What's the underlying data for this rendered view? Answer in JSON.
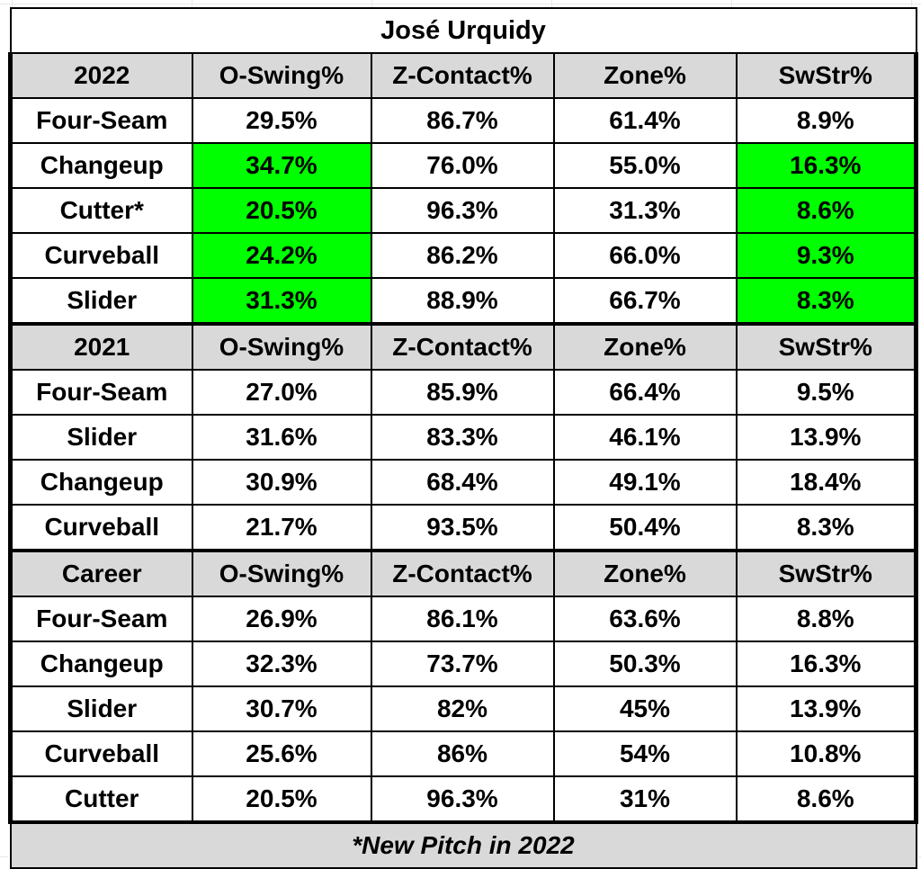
{
  "title": "José Urquidy",
  "footnote": "*New Pitch in 2022",
  "colors": {
    "highlight": "#00ff00",
    "header_gray": "#d9d9d9",
    "border": "#000000",
    "cell_bg": "#ffffff"
  },
  "sections": [
    {
      "id": "2022",
      "headers": [
        "2022",
        "O-Swing%",
        "Z-Contact%",
        "Zone%",
        "SwStr%"
      ],
      "rows": [
        {
          "pitch": "Four-Seam",
          "o_swing": "29.5%",
          "z_contact": "86.7%",
          "zone": "61.4%",
          "swstr": "8.9%",
          "hl_o_swing": false,
          "hl_swstr": false
        },
        {
          "pitch": "Changeup",
          "o_swing": "34.7%",
          "z_contact": "76.0%",
          "zone": "55.0%",
          "swstr": "16.3%",
          "hl_o_swing": true,
          "hl_swstr": true
        },
        {
          "pitch": "Cutter*",
          "o_swing": "20.5%",
          "z_contact": "96.3%",
          "zone": "31.3%",
          "swstr": "8.6%",
          "hl_o_swing": true,
          "hl_swstr": true
        },
        {
          "pitch": "Curveball",
          "o_swing": "24.2%",
          "z_contact": "86.2%",
          "zone": "66.0%",
          "swstr": "9.3%",
          "hl_o_swing": true,
          "hl_swstr": true
        },
        {
          "pitch": "Slider",
          "o_swing": "31.3%",
          "z_contact": "88.9%",
          "zone": "66.7%",
          "swstr": "8.3%",
          "hl_o_swing": true,
          "hl_swstr": true
        }
      ]
    },
    {
      "id": "2021",
      "headers": [
        "2021",
        "O-Swing%",
        "Z-Contact%",
        "Zone%",
        "SwStr%"
      ],
      "rows": [
        {
          "pitch": "Four-Seam",
          "o_swing": "27.0%",
          "z_contact": "85.9%",
          "zone": "66.4%",
          "swstr": "9.5%",
          "hl_o_swing": false,
          "hl_swstr": false
        },
        {
          "pitch": "Slider",
          "o_swing": "31.6%",
          "z_contact": "83.3%",
          "zone": "46.1%",
          "swstr": "13.9%",
          "hl_o_swing": false,
          "hl_swstr": false
        },
        {
          "pitch": "Changeup",
          "o_swing": "30.9%",
          "z_contact": "68.4%",
          "zone": "49.1%",
          "swstr": "18.4%",
          "hl_o_swing": false,
          "hl_swstr": false
        },
        {
          "pitch": "Curveball",
          "o_swing": "21.7%",
          "z_contact": "93.5%",
          "zone": "50.4%",
          "swstr": "8.3%",
          "hl_o_swing": false,
          "hl_swstr": false
        }
      ]
    },
    {
      "id": "Career",
      "headers": [
        "Career",
        "O-Swing%",
        "Z-Contact%",
        "Zone%",
        "SwStr%"
      ],
      "rows": [
        {
          "pitch": "Four-Seam",
          "o_swing": "26.9%",
          "z_contact": "86.1%",
          "zone": "63.6%",
          "swstr": "8.8%",
          "hl_o_swing": false,
          "hl_swstr": false
        },
        {
          "pitch": "Changeup",
          "o_swing": "32.3%",
          "z_contact": "73.7%",
          "zone": "50.3%",
          "swstr": "16.3%",
          "hl_o_swing": false,
          "hl_swstr": false
        },
        {
          "pitch": "Slider",
          "o_swing": "30.7%",
          "z_contact": "82%",
          "zone": "45%",
          "swstr": "13.9%",
          "hl_o_swing": false,
          "hl_swstr": false
        },
        {
          "pitch": "Curveball",
          "o_swing": "25.6%",
          "z_contact": "86%",
          "zone": "54%",
          "swstr": "10.8%",
          "hl_o_swing": false,
          "hl_swstr": false
        },
        {
          "pitch": "Cutter",
          "o_swing": "20.5%",
          "z_contact": "96.3%",
          "zone": "31%",
          "swstr": "8.6%",
          "hl_o_swing": false,
          "hl_swstr": false
        }
      ]
    }
  ]
}
